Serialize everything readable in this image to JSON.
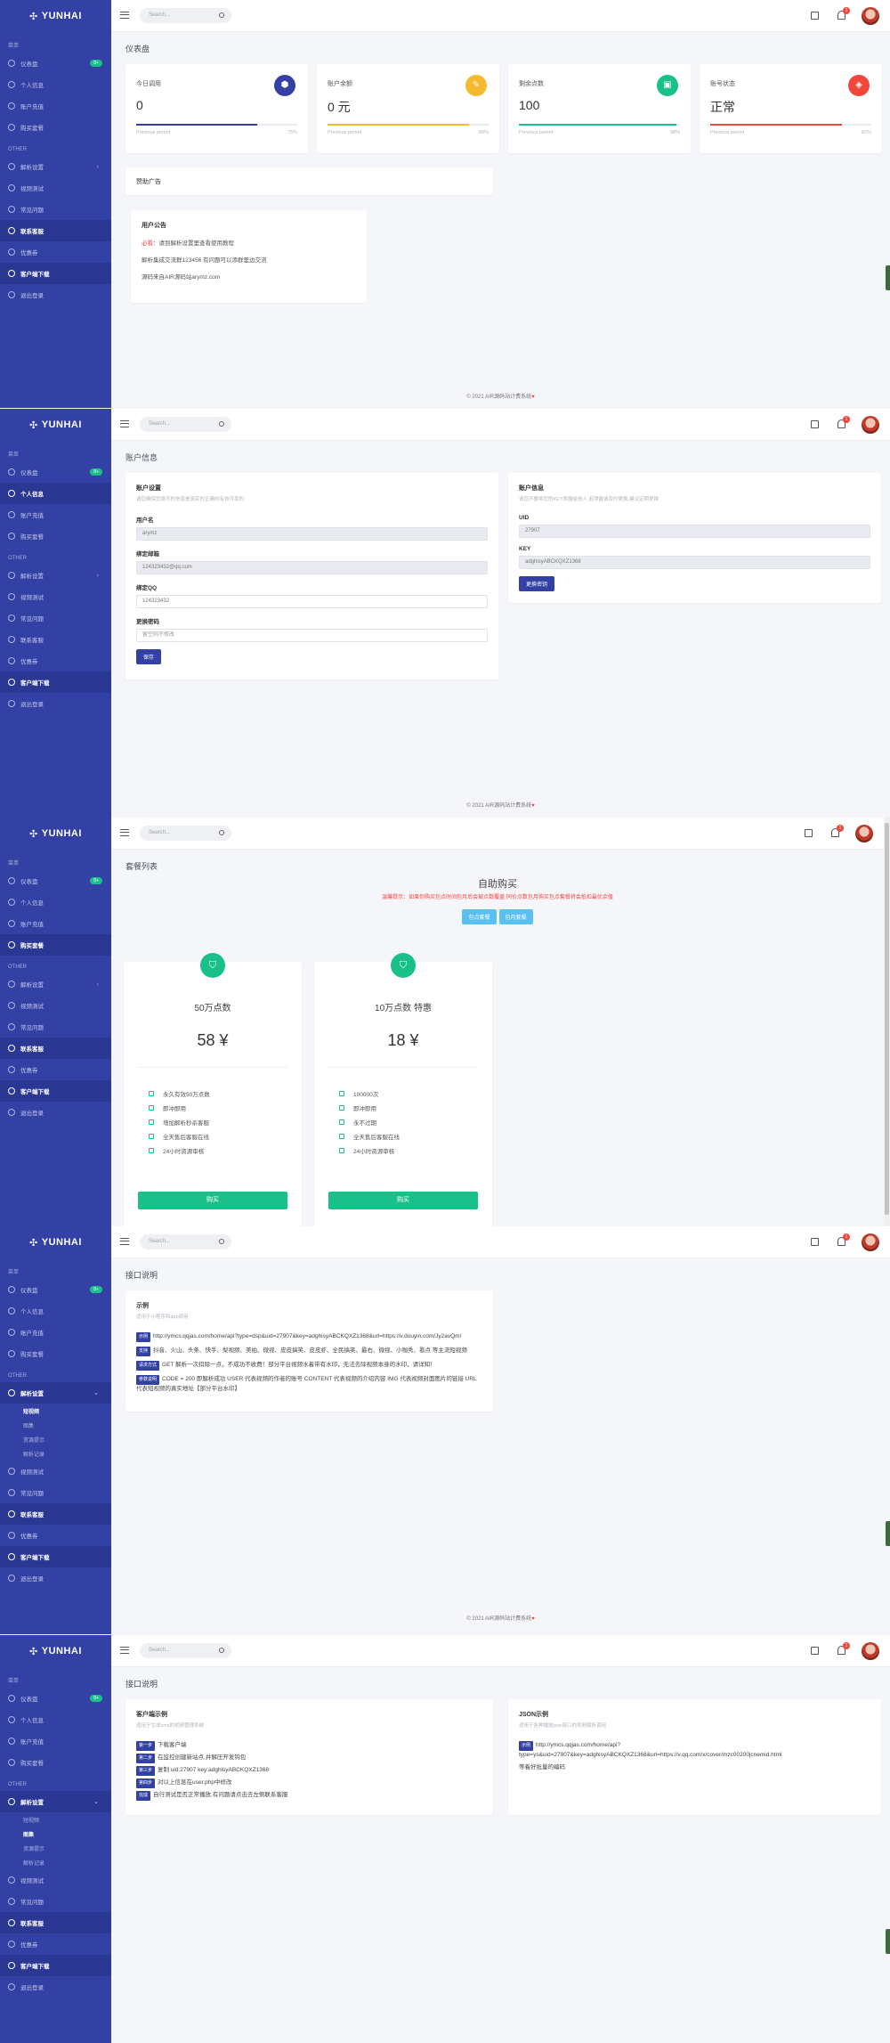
{
  "brand": "YUNHAI",
  "search_placeholder": "Search...",
  "notif_count": "1",
  "footer": "© 2021 AIR源码站计费系统",
  "heart": "♥",
  "menu": {
    "sec_main": "菜单",
    "sec_other": "OTHER",
    "dashboard": "仪表盘",
    "dashboard_badge": "8+",
    "personal": "个人信息",
    "recharge": "账户充值",
    "buy": "购买套餐",
    "parse": "解析设置",
    "video_test": "视频测试",
    "faq": "常见问题",
    "contact": "联系客服",
    "other_tab": "优惠券",
    "client": "客户端下载",
    "logout": "退出登录",
    "sub_parse": [
      "短视频",
      "图集",
      "资源提示",
      "解析记录"
    ]
  },
  "s1": {
    "title": "仪表盘",
    "stats": [
      {
        "label": "今日调用",
        "value": "0",
        "color": "#3341a4",
        "icon": "cube-icon",
        "glyph": "⬢",
        "pct_text": "75%",
        "pct": 0.75,
        "pp": "Previous period"
      },
      {
        "label": "账户余额",
        "value": "0 元",
        "color": "#f5b92e",
        "icon": "tag-icon",
        "glyph": "✎",
        "pct_text": "88%",
        "pct": 0.88,
        "pp": "Previous period"
      },
      {
        "label": "剩余点数",
        "value": "100",
        "color": "#19c08a",
        "icon": "briefcase-icon",
        "glyph": "▣",
        "pct_text": "98%",
        "pct": 0.98,
        "pp": "Previous period"
      },
      {
        "label": "账号状态",
        "value": "正常",
        "color": "#f0463c",
        "icon": "layers-icon",
        "glyph": "◈",
        "pct_text": "82%",
        "pct": 0.82,
        "pp": "Previous period"
      }
    ],
    "ad_title": "赞助广告",
    "notice_title": "用户公告",
    "notice_lines": [
      {
        "prefix": "必看：",
        "text": "请到解析设置里查看使用教程"
      },
      {
        "prefix": "",
        "text": "解析集成交流群123456 有问题可以添群里边交流"
      },
      {
        "prefix": "",
        "text": "源码来自AIR源码站arymz.com"
      }
    ]
  },
  "s2": {
    "title": "账户信息",
    "left_title": "账户设置",
    "left_sub": "请您确保您填写的信息是真实的正确的有效可靠的",
    "f_user": "用户名",
    "v_user": "arymz",
    "f_email": "绑定邮箱",
    "v_email": "124323432@qq.com",
    "f_qq": "绑定QQ",
    "v_qq": "124323432",
    "f_pwd": "更换密码",
    "ph_pwd": "留空则不修改",
    "save": "保存",
    "right_title": "账户信息",
    "right_sub": "请您不要将您的KEY泄露给他人,若泄露请及时更换,建议定期更换",
    "f_uid": "UID",
    "v_uid": "27907",
    "f_key": "KEY",
    "v_key": "adghisyABCKQXZ1368",
    "change_key": "更换密钥"
  },
  "s3": {
    "title": "套餐列表",
    "heading": "自助购买",
    "warn": "温馨提示：如果你购买包点时间包月后会被点数覆盖 同价点数包月购买包点套餐将会抵扣最优余值",
    "tab1": "包点套餐",
    "tab2": "包月套餐",
    "plans": [
      {
        "name": "50万点数",
        "price": "58 ¥",
        "features": [
          "永久有效50万点数",
          "即冲即用",
          "增加解析秒杀客服",
          "全天售后客服在线",
          "24小时资源审核"
        ],
        "buy": "购买"
      },
      {
        "name": "10万点数 特惠",
        "price": "18 ¥",
        "features": [
          "100000次",
          "即冲即用",
          "永不过期",
          "全天售后客服在线",
          "24小时资源审核"
        ],
        "buy": "购买"
      }
    ]
  },
  "s4": {
    "title": "接口说明",
    "card_title": "示例",
    "card_sub": "适用于小程序和app调用",
    "t1": "示例",
    "l1": "http://ymcs.qqjas.com/home/api?type=dsp&uid=27907&key=adghisyABCKQXZ1368&url=https://v.douyin.com/Jy2avQm/",
    "t2": "支持",
    "l2": "抖音、火山、头条、快手、梨视频、美拍、微视、皮皮搞笑、皮皮虾、全民搞笑、最右、微视、小咖秀、看点 等主流短视频",
    "t3": "请求方式",
    "l3": "GET 解析一次扣除一点，不成功不收费！部分平台视频水着带有水印，无法去除视频本身的水印，请详知！",
    "t4": "参数说明",
    "l4": "CODE = 200 即解析成功 USER 代表视频的作者的账号 CONTENT 代表视频的介绍内容 IMG 代表视频封面图片的链接 URL 代表短视频的真实地址【部分平台水印】"
  },
  "s5": {
    "title": "接口说明",
    "left_title": "客户端示例",
    "left_sub": "适用于生成cms的视频管理系统",
    "steps": [
      {
        "tag": "第一步",
        "text": "下载客户端"
      },
      {
        "tag": "第二步",
        "text": "在监控创建新站点,并解压开发钩包"
      },
      {
        "tag": "第三步",
        "text": "复制 uid:27907 key:adghisyABCKQXZ1368"
      },
      {
        "tag": "第四步",
        "text": "对以上信息在user.php中修改"
      },
      {
        "tag": "完成",
        "text": "自行测试是否正常播放,有问题请点击去左侧联系客服"
      }
    ],
    "right_title": "JSON示例",
    "right_sub": "适用于各种播放json接口的视频解析调用",
    "json_tag": "示例",
    "json_url": "http://ymcs.qqjas.com/home/api?type=ys&uid=27907&key=adghisyABCKQXZ1368&url=https://v.qq.com/x/cover/mzc00200jcnemid.html",
    "json_note": "等着好批量的编码"
  },
  "colors": {
    "sidebar": "#3341a4",
    "accent": "#3341a4",
    "success": "#19c08a",
    "danger": "#f0463c",
    "warning": "#f5b92e"
  }
}
